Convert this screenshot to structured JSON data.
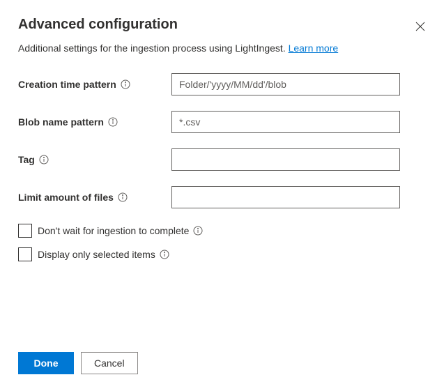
{
  "title": "Advanced configuration",
  "subtitle_text": "Additional settings for the ingestion process using LightIngest. ",
  "learn_more": "Learn more",
  "fields": {
    "creation_time": {
      "label": "Creation time pattern",
      "placeholder": "Folder/'yyyy/MM/dd'/blob",
      "value": ""
    },
    "blob_name": {
      "label": "Blob name pattern",
      "placeholder": "*.csv",
      "value": ""
    },
    "tag": {
      "label": "Tag",
      "placeholder": "",
      "value": ""
    },
    "limit_files": {
      "label": "Limit amount of files",
      "placeholder": "",
      "value": ""
    }
  },
  "checkboxes": {
    "dont_wait": "Don't wait for ingestion to complete",
    "display_selected": "Display only selected items"
  },
  "buttons": {
    "done": "Done",
    "cancel": "Cancel"
  }
}
